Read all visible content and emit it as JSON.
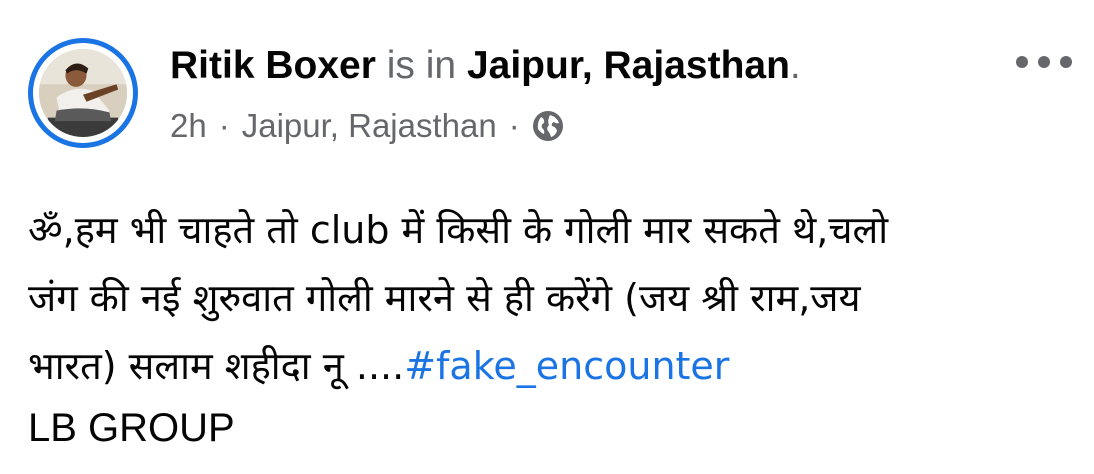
{
  "post": {
    "author": "Ritik Boxer",
    "is_in_text": "is in",
    "place": "Jaipur, Rajasthan",
    "place_suffix": ".",
    "time": "2h",
    "separator": "·",
    "location": "Jaipur, Rajasthan",
    "audience_icon": "globe-icon",
    "more_icon": "more-dots-icon",
    "body_lines": [
      "ॐ,हम भी चाहते तो club में किसी के गोली मार सकते थे,चलो",
      "जंग की नई शुरुवात गोली मारने से ही करेंगे (जय श्री राम,जय",
      "भारत) सलाम शहीदा नू ...."
    ],
    "hashtag": "#fake_encounter",
    "signature": "LB GROUP"
  },
  "colors": {
    "accent": "#1b74e4",
    "muted": "#65676b",
    "text": "#050505"
  }
}
